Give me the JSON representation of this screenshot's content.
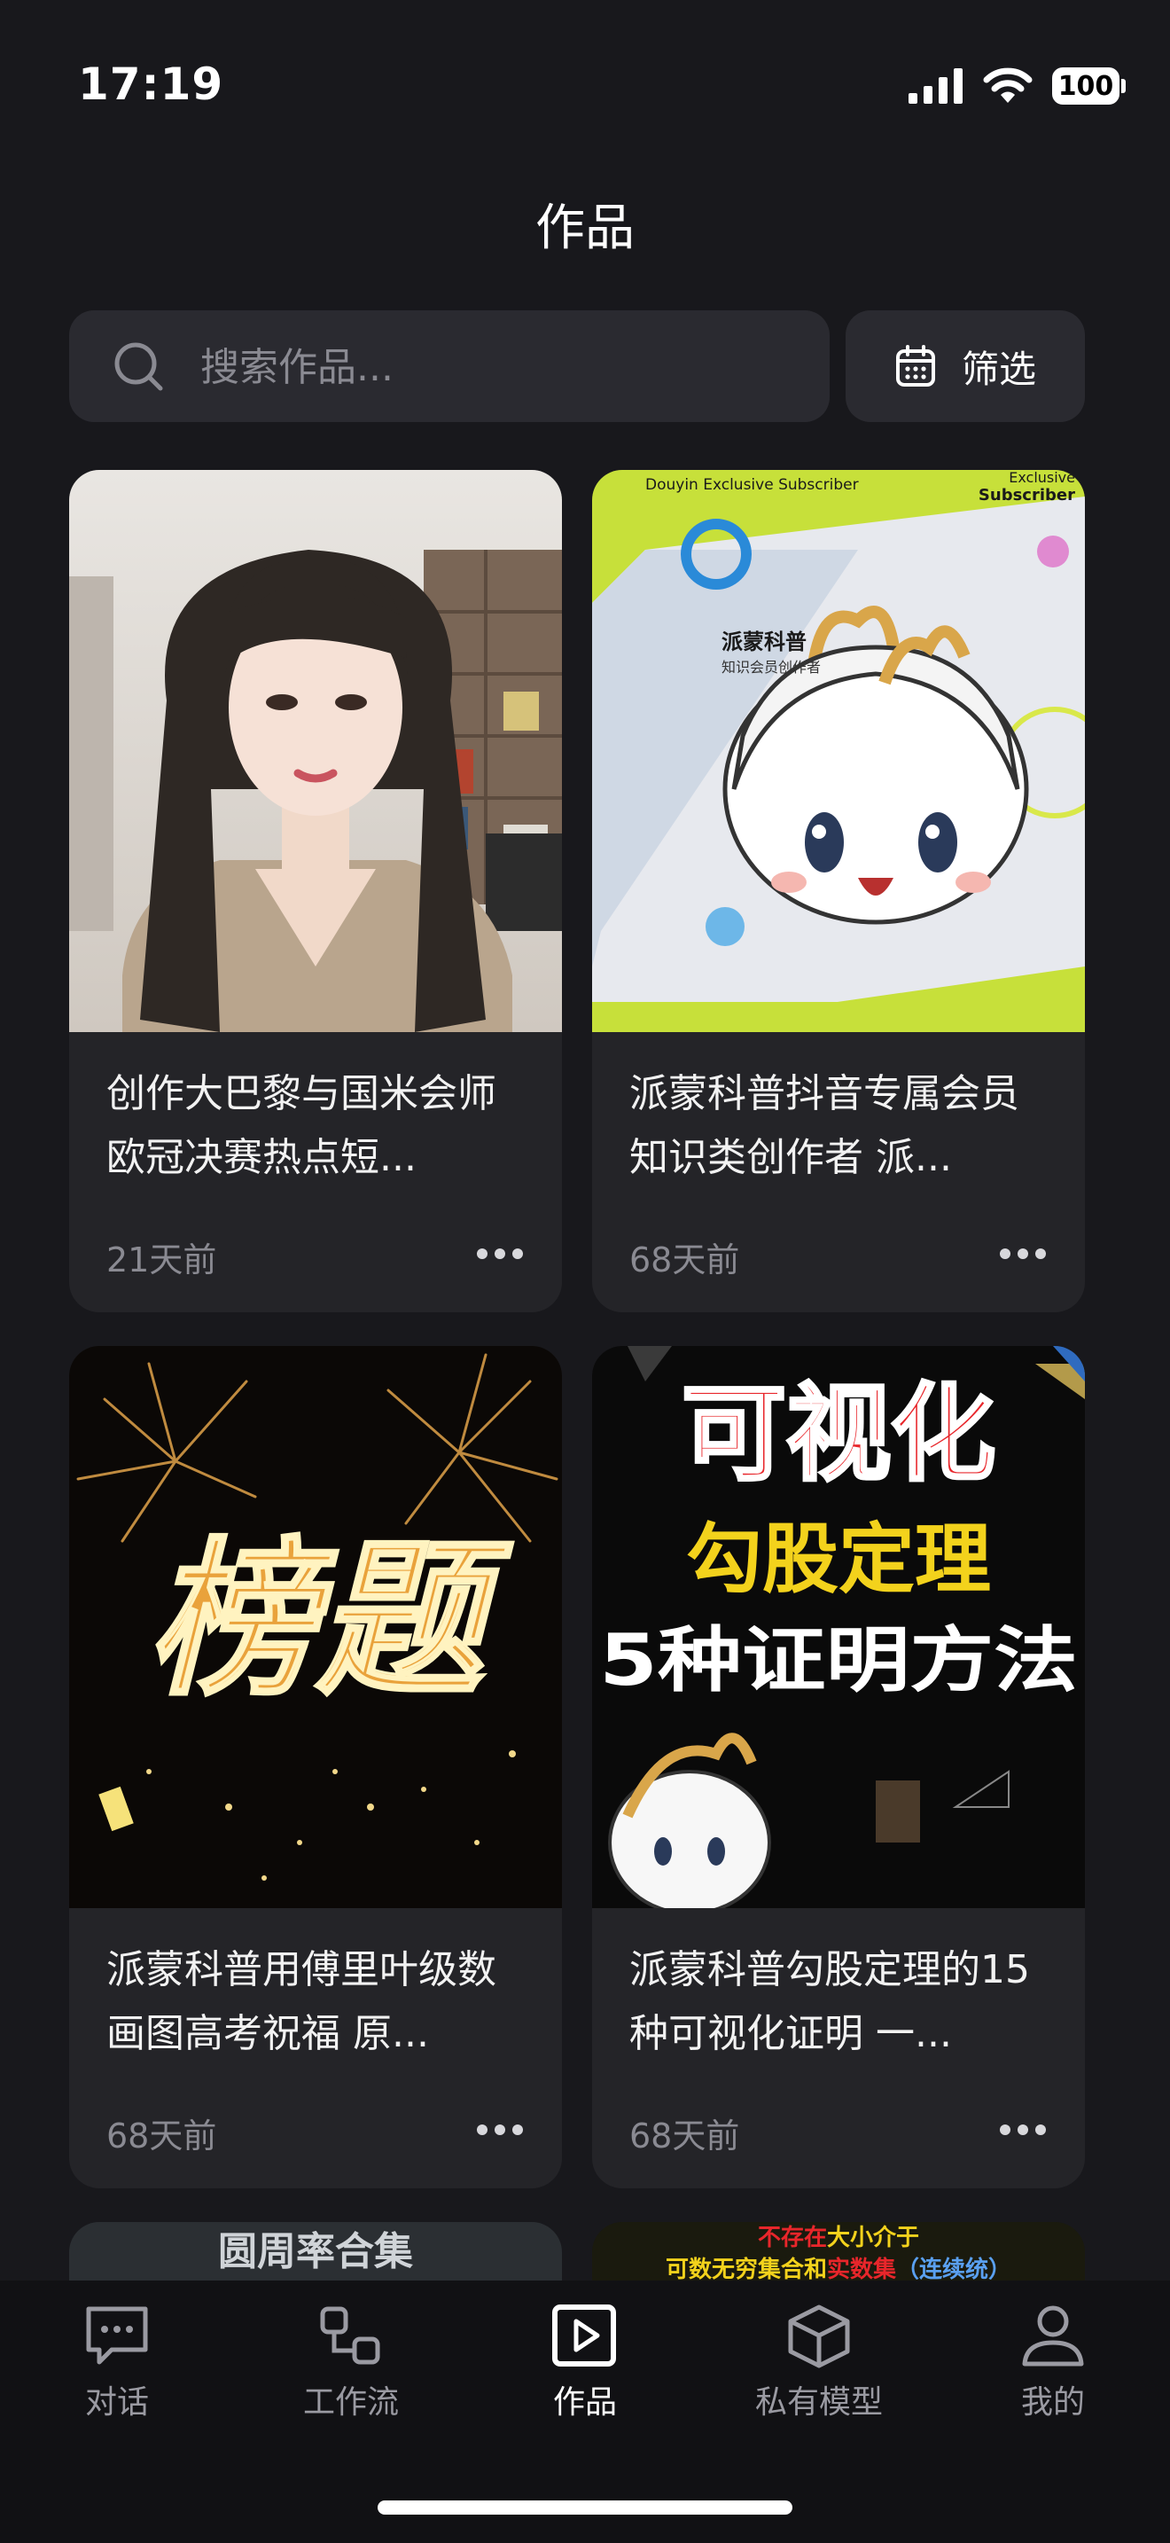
{
  "status_bar": {
    "time": "17:19",
    "battery": "100"
  },
  "header": {
    "title": "作品"
  },
  "search": {
    "placeholder": "搜索作品..."
  },
  "filter": {
    "label": "筛选"
  },
  "works": [
    {
      "title": "创作大巴黎与国米会师欧冠决赛热点短...",
      "time": "21天前"
    },
    {
      "title": "派蒙科普抖音专属会员知识类创作者 派...",
      "time": "68天前",
      "thumb": {
        "badge_en": "Douyin Exclusive Subscriber",
        "corner_en_1": "Exclusive",
        "corner_en_2": "Subscriber",
        "name": "派蒙科普",
        "subtitle": "知识会员创作者"
      }
    },
    {
      "title": "派蒙科普用傅里叶级数画图高考祝福 原...",
      "time": "68天前",
      "thumb": {
        "calligraphy": "榜题"
      }
    },
    {
      "title": "派蒙科普勾股定理的15种可视化证明 一...",
      "time": "68天前",
      "thumb": {
        "line1": "可视化",
        "line2": "勾股定理",
        "line3": "5种证明方法"
      }
    }
  ],
  "partial_works": [
    {
      "text": "圆周率合集"
    },
    {
      "line1_a": "不存在",
      "line1_b": "大小介于",
      "line2_a": "可数无穷集合和",
      "line2_b": "实数集",
      "line2_c": "（连续统）"
    }
  ],
  "tabs": [
    {
      "label": "对话",
      "icon": "chat-icon"
    },
    {
      "label": "工作流",
      "icon": "workflow-icon"
    },
    {
      "label": "作品",
      "icon": "play-icon"
    },
    {
      "label": "私有模型",
      "icon": "cube-icon"
    },
    {
      "label": "我的",
      "icon": "user-icon"
    }
  ],
  "colors": {
    "background": "#18181c",
    "card": "#242428",
    "lime": "#c7e03a",
    "red_title": "#e8262b",
    "yellow_title": "#f3d21c"
  }
}
